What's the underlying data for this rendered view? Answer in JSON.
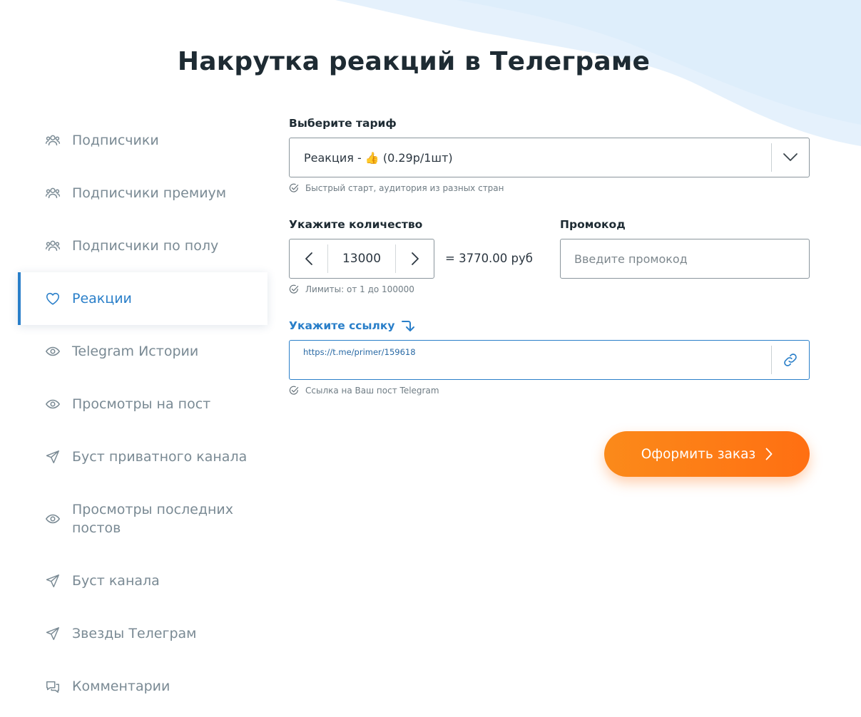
{
  "page_title": "Накрутка реакций в Телеграме",
  "sidebar": {
    "items": [
      {
        "label": "Подписчики",
        "icon": "users-icon",
        "active": false
      },
      {
        "label": "Подписчики премиум",
        "icon": "users-icon",
        "active": false
      },
      {
        "label": "Подписчики по полу",
        "icon": "users-icon",
        "active": false
      },
      {
        "label": "Реакции",
        "icon": "heart-icon",
        "active": true
      },
      {
        "label": "Telegram Истории",
        "icon": "eye-icon",
        "active": false
      },
      {
        "label": "Просмотры на пост",
        "icon": "eye-icon",
        "active": false
      },
      {
        "label": "Буст приватного канала",
        "icon": "paper-plane-icon",
        "active": false
      },
      {
        "label": "Просмотры последних постов",
        "icon": "eye-icon",
        "active": false
      },
      {
        "label": "Буст канала",
        "icon": "paper-plane-icon",
        "active": false
      },
      {
        "label": "Звезды Телеграм",
        "icon": "paper-plane-icon",
        "active": false
      },
      {
        "label": "Комментарии",
        "icon": "comments-icon",
        "active": false
      }
    ]
  },
  "form": {
    "tariff": {
      "label": "Выберите тариф",
      "value_prefix": "Реакция - ",
      "value_emoji": "👍",
      "value_suffix": " (0.29р/1шт)",
      "hint": "Быстрый старт, аудитория из разных стран"
    },
    "quantity": {
      "label": "Укажите количество",
      "value": "13000",
      "total": "= 3770.00 руб",
      "hint": "Лимиты: от 1 до 100000"
    },
    "promo": {
      "label": "Промокод",
      "placeholder": "Введите промокод"
    },
    "link": {
      "label": "Укажите ссылку",
      "value": "https://t.me/primer/159618",
      "hint": "Ссылка на Ваш пост Telegram"
    },
    "submit_label": "Оформить заказ"
  },
  "colors": {
    "accent": "#2a7fc9",
    "button": "#ff7a14",
    "wave": "#e3f0fc"
  }
}
